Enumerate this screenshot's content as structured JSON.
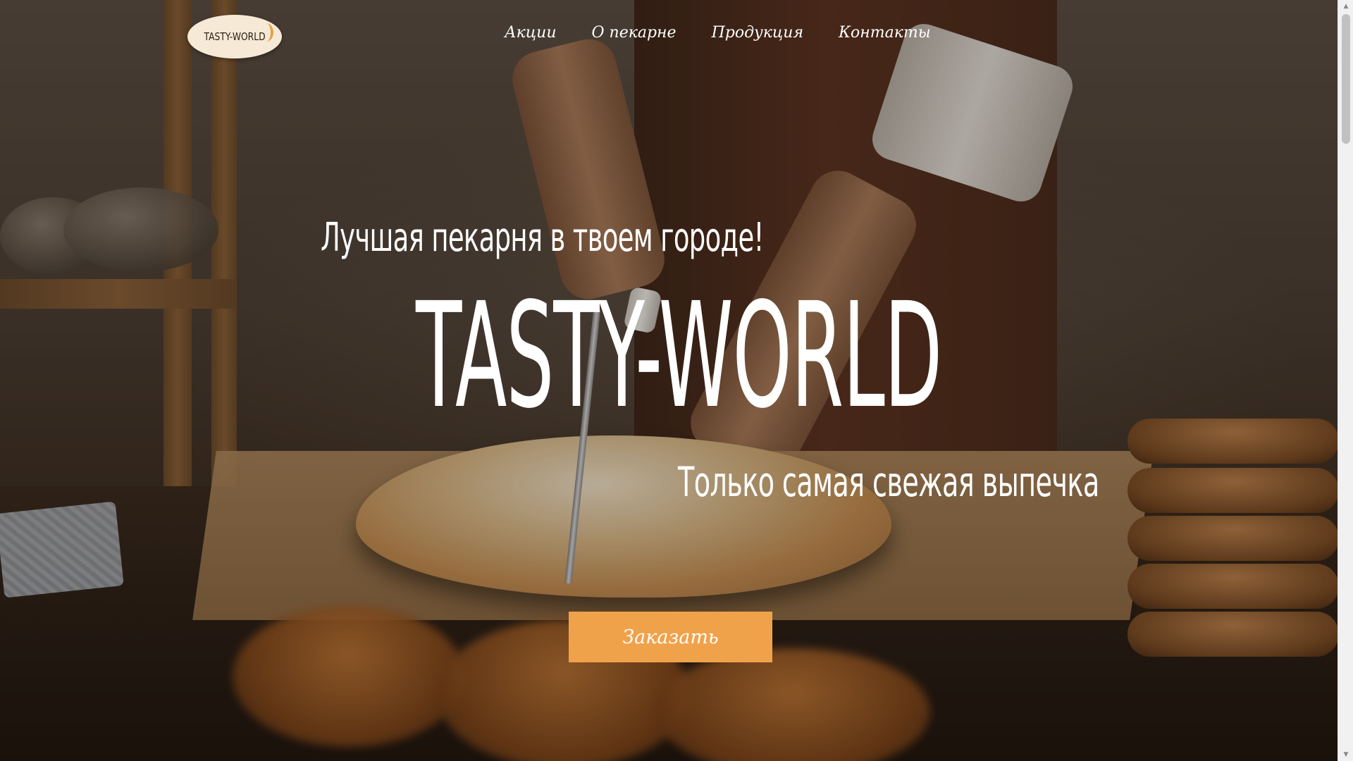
{
  "header": {
    "logo_text": "TASTY-WORLD",
    "nav": [
      {
        "label": "Акции"
      },
      {
        "label": "О пекарне"
      },
      {
        "label": "Продукция"
      },
      {
        "label": "Контакты"
      }
    ]
  },
  "hero": {
    "subtitle": "Лучшая пекарня в твоем городе!",
    "title": "TASTY-WORLD",
    "tagline": "Только самая свежая выпечка",
    "cta_label": "Заказать",
    "background_image": "baker-cutting-bread-photo"
  },
  "colors": {
    "accent": "#f0a24a",
    "logo_bg": "#f6ead6",
    "text": "#ffffff"
  },
  "scrollbar": {
    "up_icon": "scroll-up-arrow-icon",
    "down_icon": "scroll-down-arrow-icon"
  }
}
